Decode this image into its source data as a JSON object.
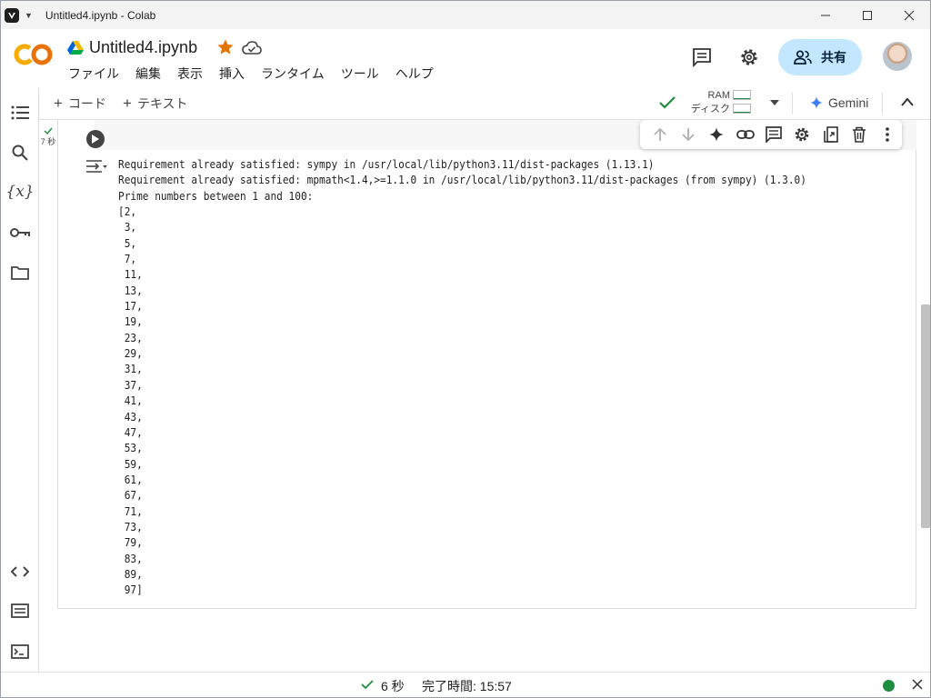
{
  "window": {
    "title": "Untitled4.ipynb - Colab"
  },
  "header": {
    "notebook_title": "Untitled4.ipynb",
    "share_label": "共有",
    "menus": [
      "ファイル",
      "編集",
      "表示",
      "挿入",
      "ランタイム",
      "ツール",
      "ヘルプ"
    ]
  },
  "toolbar": {
    "add_code": "コード",
    "add_text": "テキスト",
    "ram_label": "RAM",
    "disk_label": "ディスク",
    "gemini_label": "Gemini"
  },
  "cell": {
    "exec_time": "7 秒",
    "output_lines": [
      "Requirement already satisfied: sympy in /usr/local/lib/python3.11/dist-packages (1.13.1)",
      "Requirement already satisfied: mpmath<1.4,>=1.1.0 in /usr/local/lib/python3.11/dist-packages (from sympy) (1.3.0)",
      "Prime numbers between 1 and 100:",
      "[2,",
      " 3,",
      " 5,",
      " 7,",
      " 11,",
      " 13,",
      " 17,",
      " 19,",
      " 23,",
      " 29,",
      " 31,",
      " 37,",
      " 41,",
      " 43,",
      " 47,",
      " 53,",
      " 59,",
      " 61,",
      " 67,",
      " 71,",
      " 73,",
      " 79,",
      " 83,",
      " 89,",
      " 97]"
    ]
  },
  "statusbar": {
    "duration": "6 秒",
    "completed": "完了時間: 15:57",
    "status_color": "#1e8e3e"
  },
  "icons": {
    "rail": [
      "toc-icon",
      "search-icon",
      "variables-icon",
      "secrets-key-icon",
      "folder-icon",
      "code-snippets-icon",
      "command-palette-icon",
      "terminal-icon"
    ],
    "cell_tools": [
      "move-up-icon",
      "move-down-icon",
      "gemini-sparkle-icon",
      "link-icon",
      "comment-icon",
      "settings-icon",
      "mirror-cell-icon",
      "delete-icon",
      "more-vert-icon"
    ]
  },
  "colors": {
    "accent": "#c2e7ff",
    "colab_orange": "#f9ab00",
    "star": "#e37400"
  }
}
